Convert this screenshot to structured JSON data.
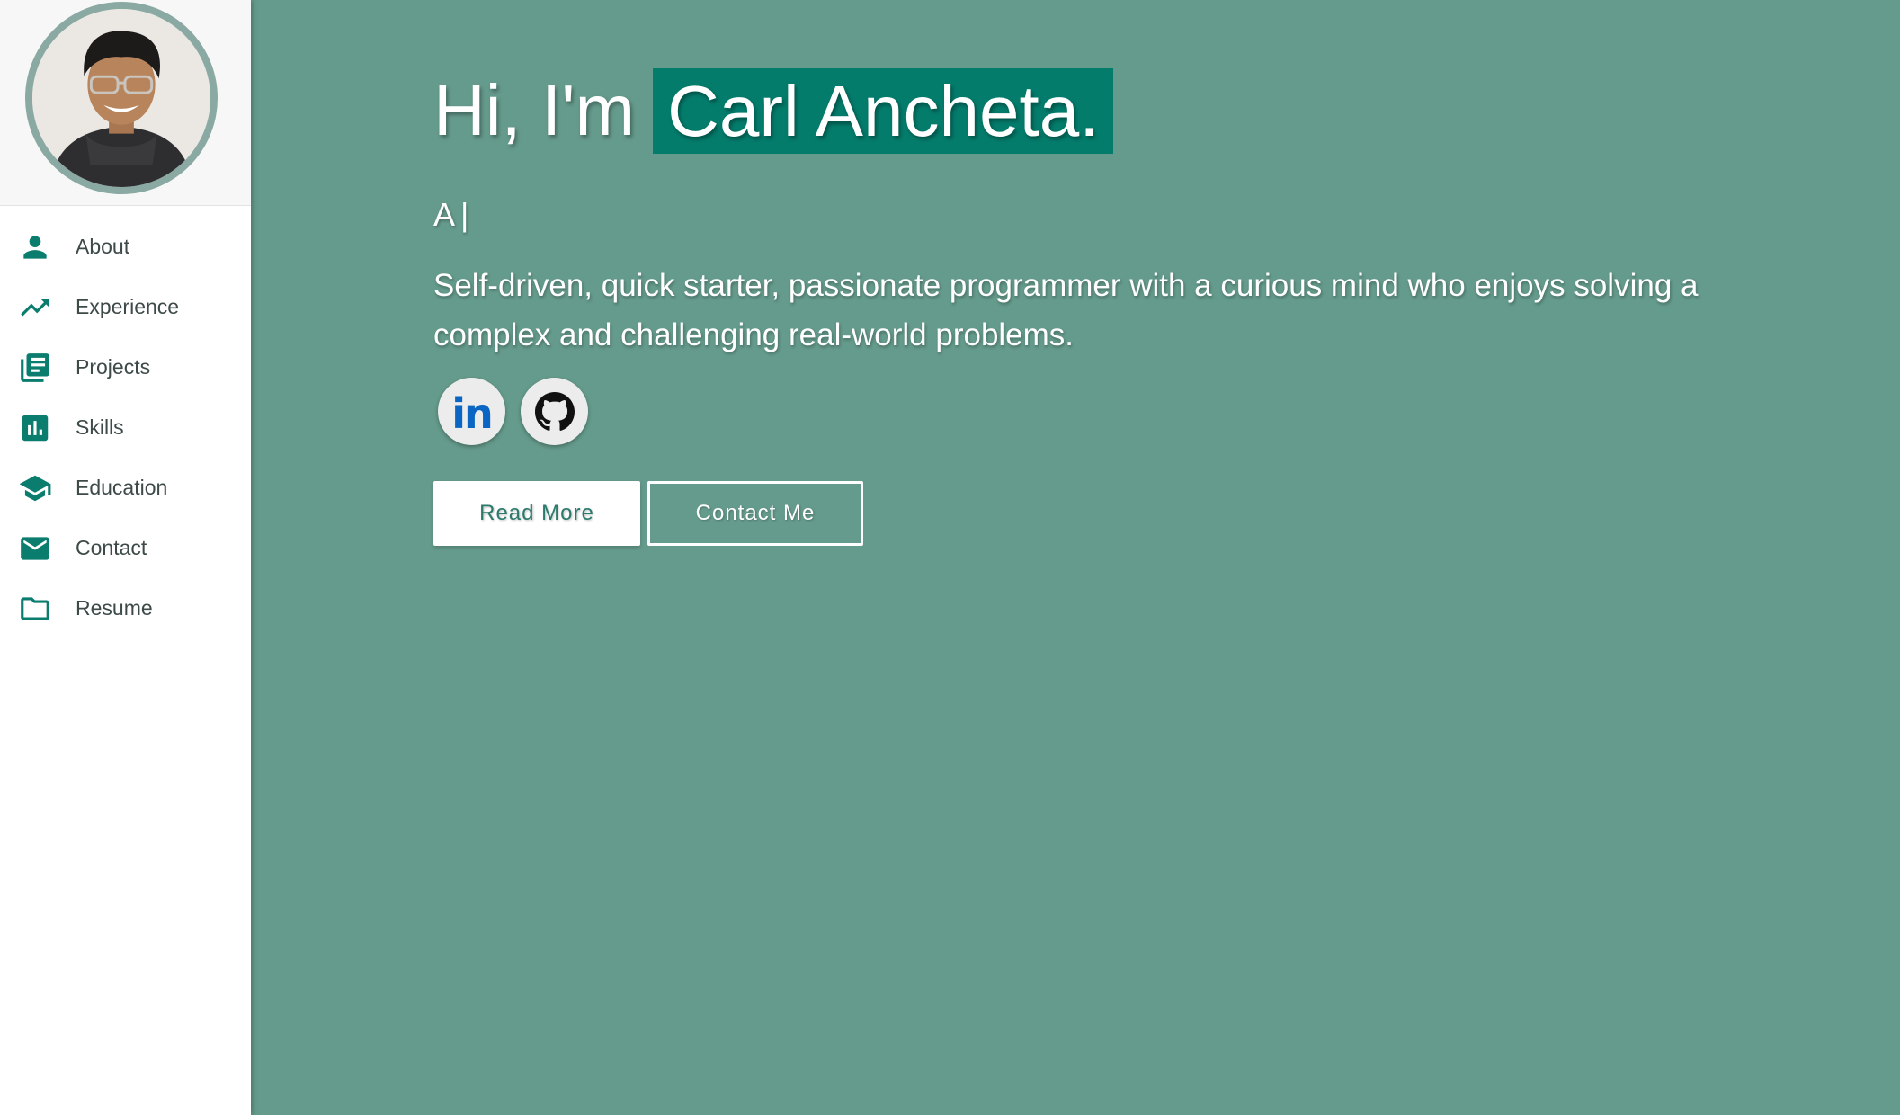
{
  "sidebar": {
    "items": [
      {
        "label": "About",
        "icon": "person-icon"
      },
      {
        "label": "Experience",
        "icon": "trending-up-icon"
      },
      {
        "label": "Projects",
        "icon": "library-books-icon"
      },
      {
        "label": "Skills",
        "icon": "bar-chart-icon"
      },
      {
        "label": "Education",
        "icon": "graduation-cap-icon"
      },
      {
        "label": "Contact",
        "icon": "mail-icon"
      },
      {
        "label": "Resume",
        "icon": "folder-icon"
      }
    ]
  },
  "hero": {
    "greeting": "Hi, I'm",
    "name": "Carl Ancheta.",
    "typing_text": "A",
    "cursor": "|",
    "summary": "Self-driven, quick starter, passionate programmer with a curious mind who enjoys solving a complex and challenging real-world problems.",
    "linkedin_text": "in"
  },
  "buttons": {
    "read_more": "Read More",
    "contact_me": "Contact Me"
  },
  "colors": {
    "background": "#659b8c",
    "accent": "#047c6c",
    "sidebar_icon": "#0b7d6e"
  }
}
